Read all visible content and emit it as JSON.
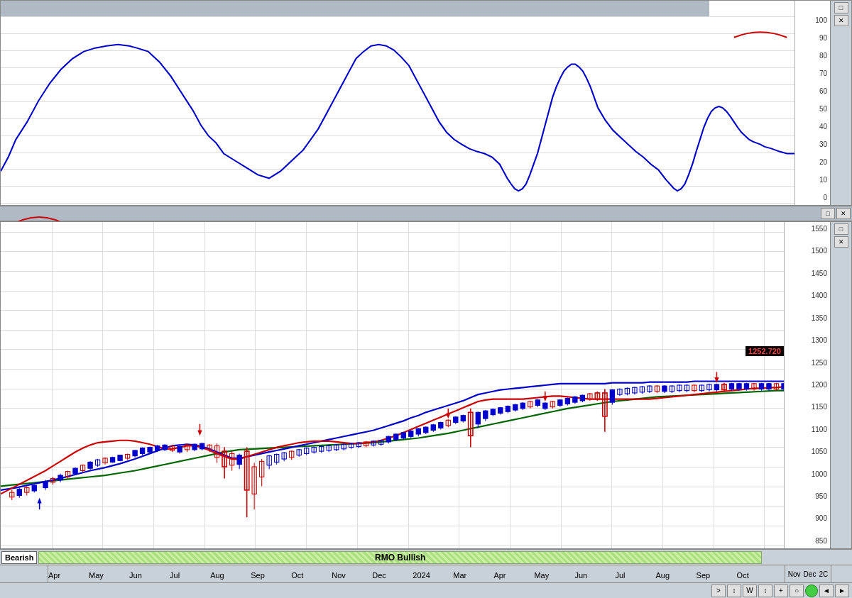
{
  "panels": {
    "top": {
      "title": "",
      "scale": [
        "100",
        "90",
        "80",
        "70",
        "60",
        "50",
        "40",
        "30",
        "20",
        "10",
        "0"
      ],
      "controls": [
        "□",
        "✕"
      ]
    },
    "bottom": {
      "title": "",
      "scale": [
        "1550",
        "1500",
        "1450",
        "1400",
        "1350",
        "1300",
        "1250",
        "1200",
        "1150",
        "1100",
        "1050",
        "1000",
        "950",
        "900",
        "850"
      ],
      "controls": [
        "□",
        "✕"
      ],
      "price_badge": "1252.720"
    }
  },
  "status": {
    "bearish_label": "Bearish",
    "rmo_label": "RMO Bullish"
  },
  "xaxis": {
    "labels": [
      "Apr",
      "May",
      "Jun",
      "Jul",
      "Aug",
      "Sep",
      "Oct",
      "Nov",
      "Dec",
      "2024",
      "Mar",
      "Apr",
      "May",
      "Jun",
      "Jul",
      "Aug",
      "Sep",
      "Oct",
      "Nov",
      "Dec",
      "2C"
    ]
  },
  "toolbar": {
    "buttons": [
      ">",
      "↕",
      "W",
      "↕",
      "+",
      "○",
      "⊙",
      "◄",
      "►"
    ]
  },
  "colors": {
    "blue_line": "#0000cc",
    "red_line": "#cc0000",
    "green_line": "#006600",
    "red_annotation": "#cc0000",
    "grid": "#dddddd",
    "header_bg": "#b0bac4",
    "panel_bg": "#c8d0d8"
  }
}
